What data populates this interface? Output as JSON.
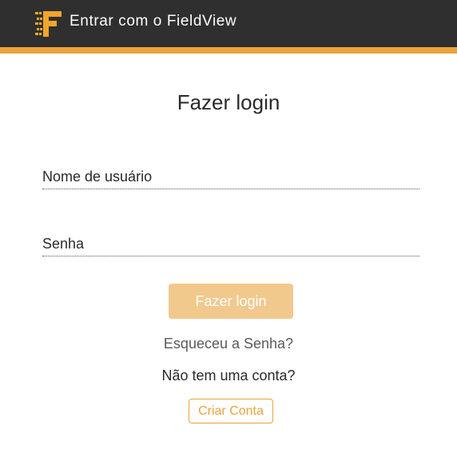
{
  "header": {
    "title": "Entrar com o FieldView",
    "logo_icon": "fieldview-logo-icon",
    "background_color": "#2f2f2f",
    "accent_color": "#e9a33b"
  },
  "login": {
    "title": "Fazer login",
    "username_placeholder": "Nome de usuário",
    "password_placeholder": "Senha",
    "submit_label": "Fazer login",
    "forgot_password_label": "Esqueceu a Senha?",
    "no_account_text": "Não tem uma conta?",
    "create_account_label": "Criar Conta",
    "button_color": "#f2c98d"
  }
}
